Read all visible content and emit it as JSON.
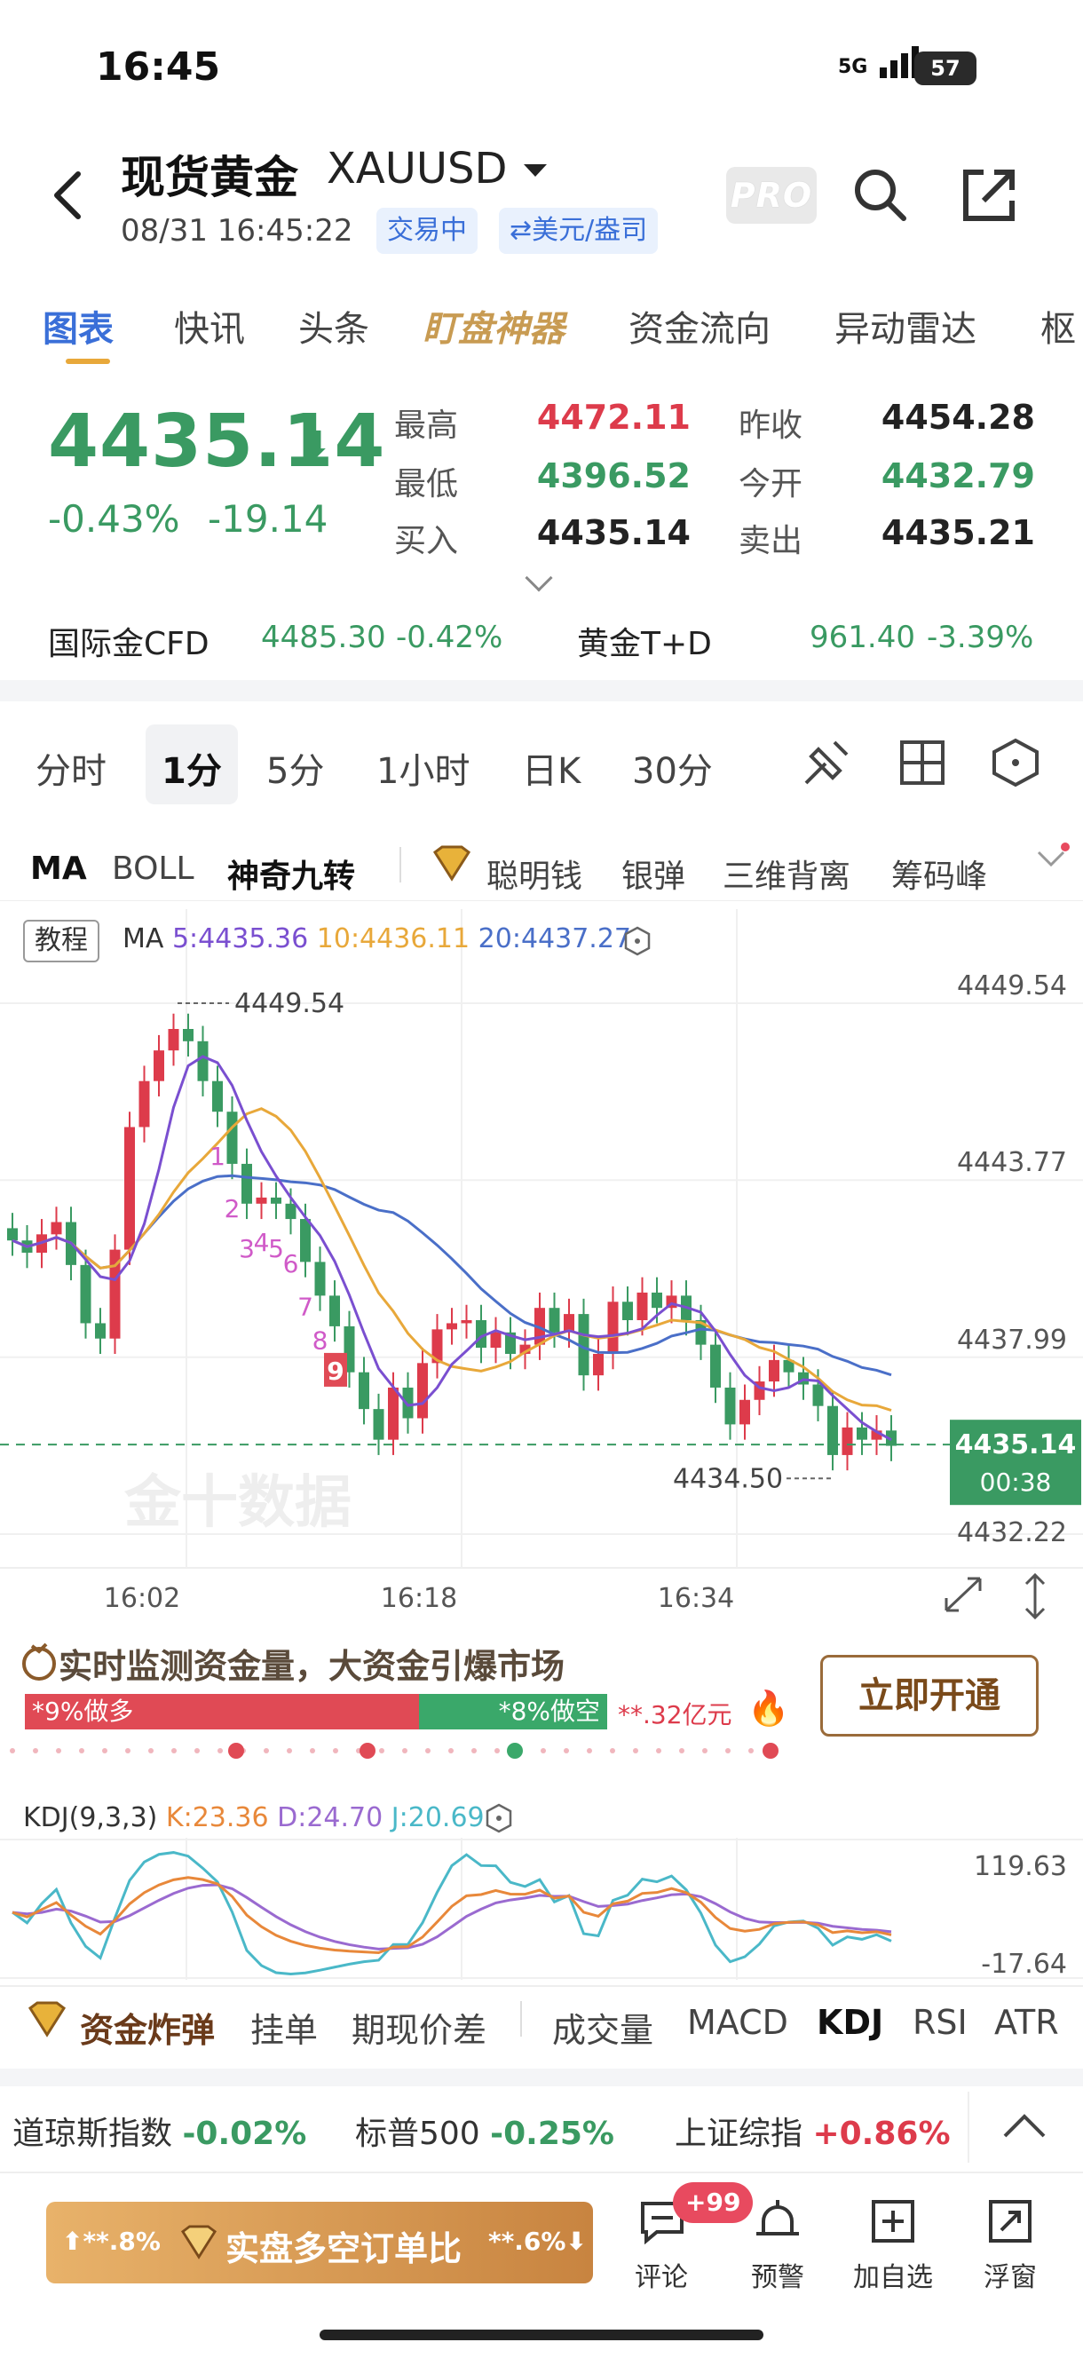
{
  "status": {
    "time": "16:45",
    "network": "5G",
    "battery": "57"
  },
  "header": {
    "title": "现货黄金",
    "symbol": "XAUUSD",
    "datetime": "08/31 16:45:22",
    "tag_trading": "交易中",
    "tag_unit": "⇄美元/盎司",
    "pro_label": "PRO"
  },
  "tabs": [
    "图表",
    "快讯",
    "头条",
    "盯盘神器",
    "资金流向",
    "异动雷达",
    "枢"
  ],
  "quote": {
    "price": "4435.14",
    "change_pct": "-0.43%",
    "change_abs": "-19.14",
    "stats": [
      {
        "label": "最高",
        "value": "4472.11",
        "color": "red"
      },
      {
        "label": "昨收",
        "value": "4454.28",
        "color": "dark"
      },
      {
        "label": "最低",
        "value": "4396.52",
        "color": "green"
      },
      {
        "label": "今开",
        "value": "4432.79",
        "color": "green"
      },
      {
        "label": "买入",
        "value": "4435.14",
        "color": "dark"
      },
      {
        "label": "卖出",
        "value": "4435.21",
        "color": "dark"
      }
    ],
    "cfd_label": "国际金CFD",
    "cfd_value": "4485.30",
    "cfd_pct": "-0.42%",
    "td_label": "黄金T+D",
    "td_value": "961.40",
    "td_pct": "-3.39%"
  },
  "periods": [
    "分时",
    "1分",
    "5分",
    "1小时",
    "日K",
    "30分"
  ],
  "indicators": [
    "MA",
    "BOLL",
    "神奇九转",
    "聪明钱",
    "银弹",
    "三维背离",
    "筹码峰"
  ],
  "chart": {
    "tutorial": "教程",
    "ma_label": "MA",
    "ma5": "5:4435.36",
    "ma10": "10:4436.11",
    "ma20": "20:4437.27",
    "high_marker": "4449.54",
    "low_marker": "4434.50",
    "current_price": "4435.14",
    "countdown": "00:38",
    "watermark": "金十数据",
    "nine_labels": [
      "1",
      "2",
      "3",
      "4",
      "5",
      "6",
      "7",
      "8",
      "9"
    ]
  },
  "chart_data": {
    "type": "candlestick",
    "y_ticks": [
      "4449.54",
      "4443.77",
      "4437.99",
      "4432.22"
    ],
    "x_ticks": [
      "16:02",
      "16:18",
      "16:34"
    ],
    "ylim": [
      4432.22,
      4449.54
    ],
    "series": [
      {
        "name": "5",
        "color": "#7a4fd0"
      },
      {
        "name": "10",
        "color": "#e8a83a"
      },
      {
        "name": "20",
        "color": "#4a6fc8"
      }
    ],
    "close": [
      4441.8,
      4441.4,
      4442.0,
      4442.4,
      4441.0,
      4439.1,
      4438.6,
      4441.5,
      4445.5,
      4447.0,
      4448.0,
      4448.7,
      4448.3,
      4447.0,
      4446.0,
      4444.3,
      4443.0,
      4443.2,
      4443.0,
      4442.5,
      4441.1,
      4440.0,
      4439.0,
      4437.5,
      4436.3,
      4435.3,
      4437.0,
      4436.0,
      4437.8,
      4438.9,
      4439.1,
      4439.2,
      4438.3,
      4438.8,
      4438.1,
      4438.4,
      4439.6,
      4438.8,
      4439.4,
      4437.4,
      4438.1,
      4439.8,
      4439.2,
      4440.1,
      4439.6,
      4440.0,
      4439.2,
      4438.4,
      4437.0,
      4435.8,
      4436.6,
      4437.2,
      4437.9,
      4437.5,
      4437.1,
      4436.4,
      4434.8,
      4435.7,
      4435.3,
      4435.6,
      4435.1
    ]
  },
  "fund": {
    "title": "实时监测资金量，大资金引爆市场",
    "long": "*9%做多",
    "short": "*8%做空",
    "amount": "**.32亿元",
    "button": "立即开通"
  },
  "kdj": {
    "label": "KDJ(9,3,3)",
    "k": "K:23.36",
    "d": "D:24.70",
    "j": "J:20.69",
    "y_top": "119.63",
    "y_bottom": "-17.64"
  },
  "bottom_tabs": [
    "资金炸弹",
    "挂单",
    "期现价差",
    "成交量",
    "MACD",
    "KDJ",
    "RSI",
    "ATR"
  ],
  "indices": [
    {
      "name": "道琼斯指数",
      "value": "-0.02%"
    },
    {
      "name": "标普500",
      "value": "-0.25%"
    },
    {
      "name": "上证综指",
      "value": "+0.86%"
    }
  ],
  "footer": {
    "left_pct": "**.8%",
    "order_label": "实盘多空订单比",
    "right_pct": "**.6%",
    "comment": "评论",
    "badge": "+99",
    "alert": "预警",
    "add": "加自选",
    "float": "浮窗"
  },
  "colors": {
    "up": "#dd3b4b",
    "down": "#3a9a62",
    "accent": "#3a6fd8",
    "gold": "#c89b52"
  }
}
